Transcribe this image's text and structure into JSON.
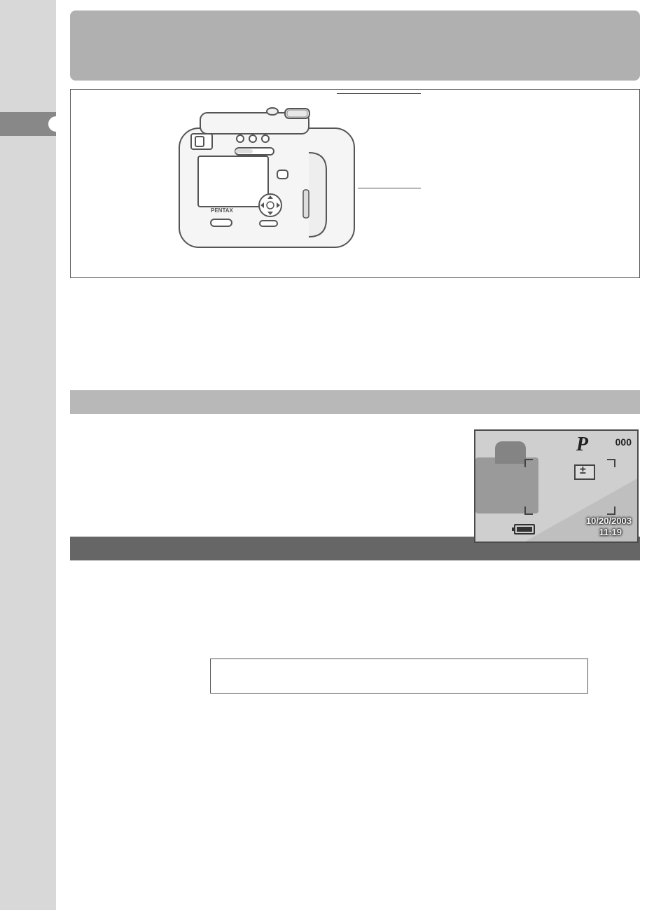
{
  "lcd": {
    "mode": "P",
    "remaining": "000",
    "date": "10/20/2003",
    "time": "11:19"
  }
}
